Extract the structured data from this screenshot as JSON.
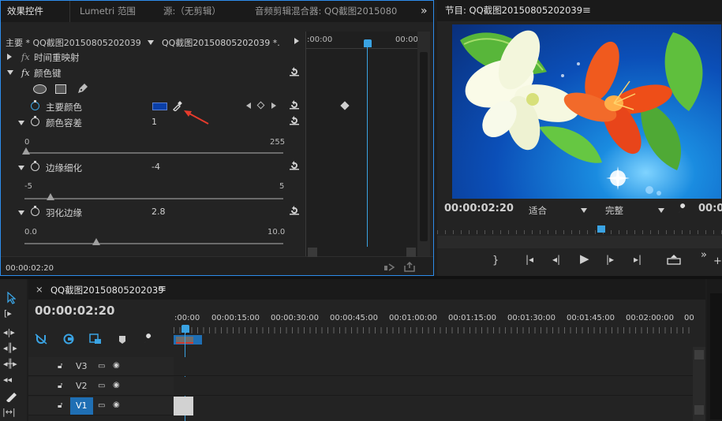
{
  "effect_controls": {
    "tabs": [
      {
        "label": "效果控件",
        "active": true
      },
      {
        "label": "Lumetri 范围",
        "active": false
      },
      {
        "label": "源:（无剪辑）",
        "active": false
      },
      {
        "label": "音频剪辑混合器: QQ截图2015080",
        "active": false
      }
    ],
    "overflow": "»",
    "master_label": "主要 * QQ截图20150805202039...",
    "clip_label": "QQ截图20150805202039 *...",
    "time_start": ":00:00",
    "time_end": "00:00",
    "time_remap": "时间重映射",
    "fx": "fx",
    "color_key": "颜色键",
    "key_color_label": "主要颜色",
    "key_color_value": "#0a3fa8",
    "tolerance_label": "颜色容差",
    "tolerance_value": "1",
    "tolerance_min": "0",
    "tolerance_max": "255",
    "edge_thin_label": "边缘细化",
    "edge_thin_value": "-4",
    "edge_thin_min": "-5",
    "edge_thin_max": "5",
    "feather_label": "羽化边缘",
    "feather_value": "2.8",
    "feather_min": "0.0",
    "feather_max": "10.0",
    "current_time": "00:00:02:20"
  },
  "program": {
    "title": "节目: QQ截图20150805202039",
    "timecode": "00:00:02:20",
    "fit": "适合",
    "quality": "完整",
    "right_time": "00:0"
  },
  "timeline": {
    "close": "×",
    "sequence": "QQ截图20150805202039",
    "timecode": "00:00:02:20",
    "ruler": [
      ":00:00",
      "00:00:15:00",
      "00:00:30:00",
      "00:00:45:00",
      "00:01:00:00",
      "00:01:15:00",
      "00:01:30:00",
      "00:01:45:00",
      "00:02:00:00",
      "00"
    ],
    "tracks": [
      "V3",
      "V2",
      "V1"
    ]
  },
  "colors": {
    "accent": "#3aa3e3",
    "panel": "#232323",
    "active_border": "#2d8ceb"
  }
}
